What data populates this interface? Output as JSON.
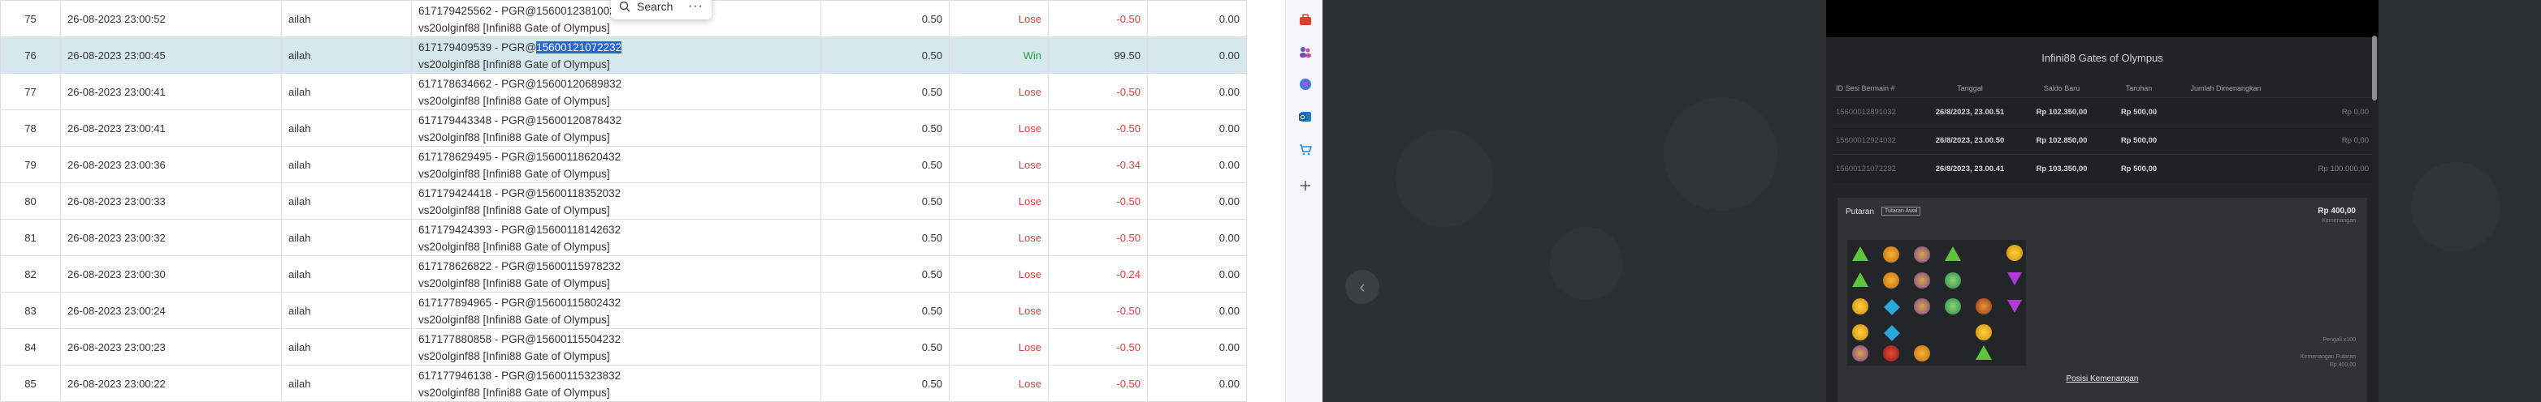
{
  "table": {
    "rows": [
      {
        "no": "75",
        "date": "26-08-2023 23:00:52",
        "user": "ailah",
        "line1_pre": "617179425562 - PGR@1560012381002",
        "line1_sel": "",
        "line2": "vs20olginf88 [Infini88 Gate of Olympus]",
        "bet": "0.50",
        "result": "Lose",
        "win": "-0.50",
        "bal": "0.00"
      },
      {
        "no": "76",
        "date": "26-08-2023 23:00:45",
        "user": "ailah",
        "line1_pre": "617179409539 - PGR@",
        "line1_sel": "15600121072232",
        "line2": "vs20olginf88 [Infini88 Gate of Olympus]",
        "bet": "0.50",
        "result": "Win",
        "win": "99.50",
        "bal": "0.00"
      },
      {
        "no": "77",
        "date": "26-08-2023 23:00:41",
        "user": "ailah",
        "line1_pre": "617178634662 - PGR@15600120689832",
        "line1_sel": "",
        "line2": "vs20olginf88 [Infini88 Gate of Olympus]",
        "bet": "0.50",
        "result": "Lose",
        "win": "-0.50",
        "bal": "0.00"
      },
      {
        "no": "78",
        "date": "26-08-2023 23:00:41",
        "user": "ailah",
        "line1_pre": "617179443348 - PGR@15600120878432",
        "line1_sel": "",
        "line2": "vs20olginf88 [Infini88 Gate of Olympus]",
        "bet": "0.50",
        "result": "Lose",
        "win": "-0.50",
        "bal": "0.00"
      },
      {
        "no": "79",
        "date": "26-08-2023 23:00:36",
        "user": "ailah",
        "line1_pre": "617178629495 - PGR@15600118620432",
        "line1_sel": "",
        "line2": "vs20olginf88 [Infini88 Gate of Olympus]",
        "bet": "0.50",
        "result": "Lose",
        "win": "-0.34",
        "bal": "0.00"
      },
      {
        "no": "80",
        "date": "26-08-2023 23:00:33",
        "user": "ailah",
        "line1_pre": "617179424418 - PGR@15600118352032",
        "line1_sel": "",
        "line2": "vs20olginf88 [Infini88 Gate of Olympus]",
        "bet": "0.50",
        "result": "Lose",
        "win": "-0.50",
        "bal": "0.00"
      },
      {
        "no": "81",
        "date": "26-08-2023 23:00:32",
        "user": "ailah",
        "line1_pre": "617179424393 - PGR@15600118142632",
        "line1_sel": "",
        "line2": "vs20olginf88 [Infini88 Gate of Olympus]",
        "bet": "0.50",
        "result": "Lose",
        "win": "-0.50",
        "bal": "0.00"
      },
      {
        "no": "82",
        "date": "26-08-2023 23:00:30",
        "user": "ailah",
        "line1_pre": "617178626822 - PGR@15600115978232",
        "line1_sel": "",
        "line2": "vs20olginf88 [Infini88 Gate of Olympus]",
        "bet": "0.50",
        "result": "Lose",
        "win": "-0.24",
        "bal": "0.00"
      },
      {
        "no": "83",
        "date": "26-08-2023 23:00:24",
        "user": "ailah",
        "line1_pre": "617177894965 - PGR@15600115802432",
        "line1_sel": "",
        "line2": "vs20olginf88 [Infini88 Gate of Olympus]",
        "bet": "0.50",
        "result": "Lose",
        "win": "-0.50",
        "bal": "0.00"
      },
      {
        "no": "84",
        "date": "26-08-2023 23:00:23",
        "user": "ailah",
        "line1_pre": "617177880858 - PGR@15600115504232",
        "line1_sel": "",
        "line2": "vs20olginf88 [Infini88 Gate of Olympus]",
        "bet": "0.50",
        "result": "Lose",
        "win": "-0.50",
        "bal": "0.00"
      },
      {
        "no": "85",
        "date": "26-08-2023 23:00:22",
        "user": "ailah",
        "line1_pre": "617177946138 - PGR@15600115323832",
        "line1_sel": "",
        "line2": "vs20olginf88 [Infini88 Gate of Olympus]",
        "bet": "0.50",
        "result": "Lose",
        "win": "-0.50",
        "bal": "0.00"
      }
    ]
  },
  "search_popup": {
    "label": "Search",
    "more": "···"
  },
  "icon_strip": {
    "icons": [
      "briefcase-icon",
      "people-icon",
      "copilot-icon",
      "outlook-icon",
      "shopping-icon",
      "add-icon"
    ]
  },
  "viewer": {
    "prev_glyph": "‹",
    "doc": {
      "title": "Infini88 Gates of Olympus",
      "headers": [
        "ID Sesi Bermain #",
        "Tanggal",
        "Saldo Baru",
        "Taruhan",
        "Jumlah Dimenangkan"
      ],
      "rows": [
        {
          "id": "15600012891032",
          "date": "26/8/2023, 23.00.51",
          "saldo": "Rp 102.350,00",
          "bet": "Rp 500,00",
          "win": "Rp 0,00"
        },
        {
          "id": "15600012924032",
          "date": "26/8/2023, 23.00.50",
          "saldo": "Rp 102.850,00",
          "bet": "Rp 500,00",
          "win": "Rp 0,00"
        },
        {
          "id": "15600121072232",
          "date": "26/8/2023, 23.00.41",
          "saldo": "Rp 103.350,00",
          "bet": "Rp 500,00",
          "win": "Rp 100.000,00"
        }
      ],
      "round": {
        "label": "Putaran",
        "badge": "Tutaran Awal",
        "amount": "Rp 400,00",
        "amount_sub": "Kemenangan",
        "pengali": "Pengali x100",
        "kemen_l1": "Kemenangan Putaran",
        "kemen_l2": "Rp 400,00",
        "posisi": "Posisi Kemenangan"
      }
    }
  }
}
